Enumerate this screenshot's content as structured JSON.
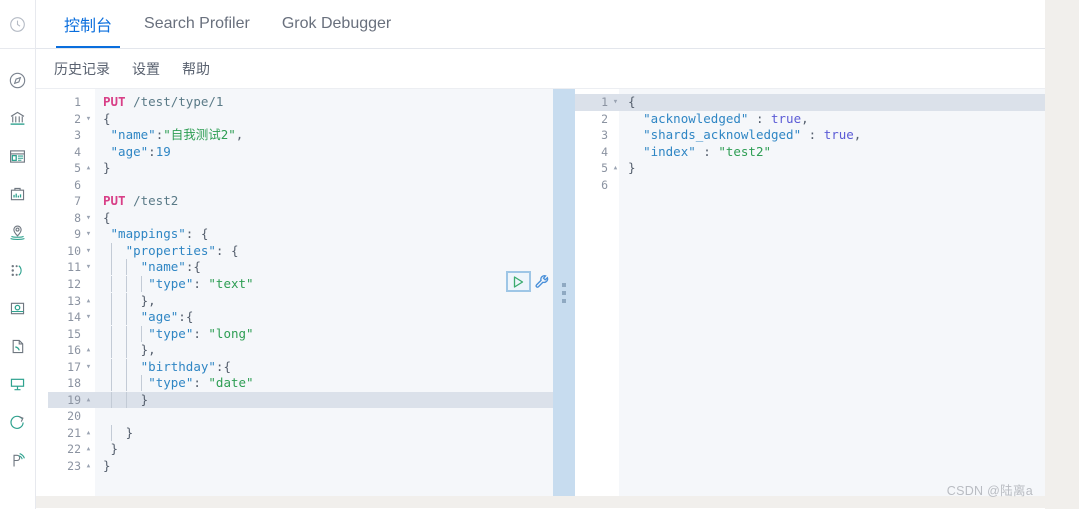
{
  "app": {
    "watermark": "CSDN @陆离a"
  },
  "rail": {
    "top_icon": "clock-history-icon",
    "items": [
      {
        "name": "compass-icon",
        "label": "Discover"
      },
      {
        "name": "bank-icon",
        "label": "Analytics"
      },
      {
        "name": "dashboard-icon",
        "label": "Dashboard"
      },
      {
        "name": "canvas-icon",
        "label": "Canvas"
      },
      {
        "name": "maps-icon",
        "label": "Maps"
      },
      {
        "name": "machine-learning-icon",
        "label": "Machine Learning"
      },
      {
        "name": "infrastructure-icon",
        "label": "Infrastructure"
      },
      {
        "name": "logs-icon",
        "label": "Logs"
      },
      {
        "name": "apm-icon",
        "label": "APM"
      },
      {
        "name": "uptime-icon",
        "label": "Uptime"
      },
      {
        "name": "devtools-icon",
        "label": "Dev Tools"
      }
    ]
  },
  "tabs": [
    {
      "label": "控制台",
      "active": true
    },
    {
      "label": "Search Profiler",
      "active": false
    },
    {
      "label": "Grok Debugger",
      "active": false
    }
  ],
  "menu": [
    {
      "label": "历史记录"
    },
    {
      "label": "设置"
    },
    {
      "label": "帮助"
    }
  ],
  "actions": {
    "run_icon": "play-icon",
    "wrench_icon": "wrench-icon"
  },
  "editor": {
    "current_line": 19,
    "lines": [
      {
        "n": 1,
        "fold": "",
        "html": "<span class='m'>PUT</span> <span class='u'>/test/type/1</span>"
      },
      {
        "n": 2,
        "fold": "▾",
        "html": "<span class='p'>{</span>"
      },
      {
        "n": 3,
        "fold": "",
        "html": " <span class='k'>\"name\"</span><span class='p'>:</span><span class='s'>\"自我测试2\"</span><span class='p'>,</span>"
      },
      {
        "n": 4,
        "fold": "",
        "html": " <span class='k'>\"age\"</span><span class='p'>:</span><span class='n'>19</span>"
      },
      {
        "n": 5,
        "fold": "▴",
        "html": "<span class='p'>}</span>"
      },
      {
        "n": 6,
        "fold": "",
        "html": ""
      },
      {
        "n": 7,
        "fold": "",
        "html": "<span class='m'>PUT</span> <span class='u'>/test2</span>"
      },
      {
        "n": 8,
        "fold": "▾",
        "html": "<span class='p'>{</span>"
      },
      {
        "n": 9,
        "fold": "▾",
        "html": " <span class='k'>\"mappings\"</span><span class='p'>: {</span>"
      },
      {
        "n": 10,
        "fold": "▾",
        "html": " <span class='guide'></span>  <span class='k'>\"properties\"</span><span class='p'>: {</span>"
      },
      {
        "n": 11,
        "fold": "▾",
        "html": " <span class='guide'></span>  <span class='guide'></span>  <span class='k'>\"name\"</span><span class='p'>:{</span>"
      },
      {
        "n": 12,
        "fold": "",
        "html": " <span class='guide'></span>  <span class='guide'></span>  <span class='guide'></span> <span class='k'>\"type\"</span><span class='p'>: </span><span class='s'>\"text\"</span>"
      },
      {
        "n": 13,
        "fold": "▴",
        "html": " <span class='guide'></span>  <span class='guide'></span>  <span class='p'>},</span>"
      },
      {
        "n": 14,
        "fold": "▾",
        "html": " <span class='guide'></span>  <span class='guide'></span>  <span class='k'>\"age\"</span><span class='p'>:{</span>"
      },
      {
        "n": 15,
        "fold": "",
        "html": " <span class='guide'></span>  <span class='guide'></span>  <span class='guide'></span> <span class='k'>\"type\"</span><span class='p'>: </span><span class='s'>\"long\"</span>"
      },
      {
        "n": 16,
        "fold": "▴",
        "html": " <span class='guide'></span>  <span class='guide'></span>  <span class='p'>},</span>"
      },
      {
        "n": 17,
        "fold": "▾",
        "html": " <span class='guide'></span>  <span class='guide'></span>  <span class='k'>\"birthday\"</span><span class='p'>:{</span>"
      },
      {
        "n": 18,
        "fold": "",
        "html": " <span class='guide'></span>  <span class='guide'></span>  <span class='guide'></span> <span class='k'>\"type\"</span><span class='p'>: </span><span class='s'>\"date\"</span>"
      },
      {
        "n": 19,
        "fold": "▴",
        "html": " <span class='guide'></span>  <span class='guide'></span>  <span class='p'>}</span>"
      },
      {
        "n": 20,
        "fold": "",
        "html": ""
      },
      {
        "n": 21,
        "fold": "▴",
        "html": " <span class='guide'></span>  <span class='p'>}</span>"
      },
      {
        "n": 22,
        "fold": "▴",
        "html": " <span class='p'>}</span>"
      },
      {
        "n": 23,
        "fold": "▴",
        "html": "<span class='p'>}</span>"
      }
    ]
  },
  "response": {
    "current_line": 1,
    "lines": [
      {
        "n": 1,
        "fold": "▾",
        "html": "<span class='p'>{</span>"
      },
      {
        "n": 2,
        "fold": "",
        "html": "  <span class='k'>\"acknowledged\"</span><span class='p'> : </span><span class='b'>true</span><span class='p'>,</span>"
      },
      {
        "n": 3,
        "fold": "",
        "html": "  <span class='k'>\"shards_acknowledged\"</span><span class='p'> : </span><span class='b'>true</span><span class='p'>,</span>"
      },
      {
        "n": 4,
        "fold": "",
        "html": "  <span class='k'>\"index\"</span><span class='p'> : </span><span class='s'>\"test2\"</span>"
      },
      {
        "n": 5,
        "fold": "▴",
        "html": "<span class='p'>}</span>"
      },
      {
        "n": 6,
        "fold": "",
        "html": ""
      }
    ]
  },
  "colors": {
    "accent": "#0a6edd",
    "method": "#d83f87",
    "string": "#2e9e54",
    "key": "#2f86c4",
    "boolean": "#5b5bd6",
    "splitter": "#c7dcef",
    "current_line": "#dbe1ea"
  }
}
